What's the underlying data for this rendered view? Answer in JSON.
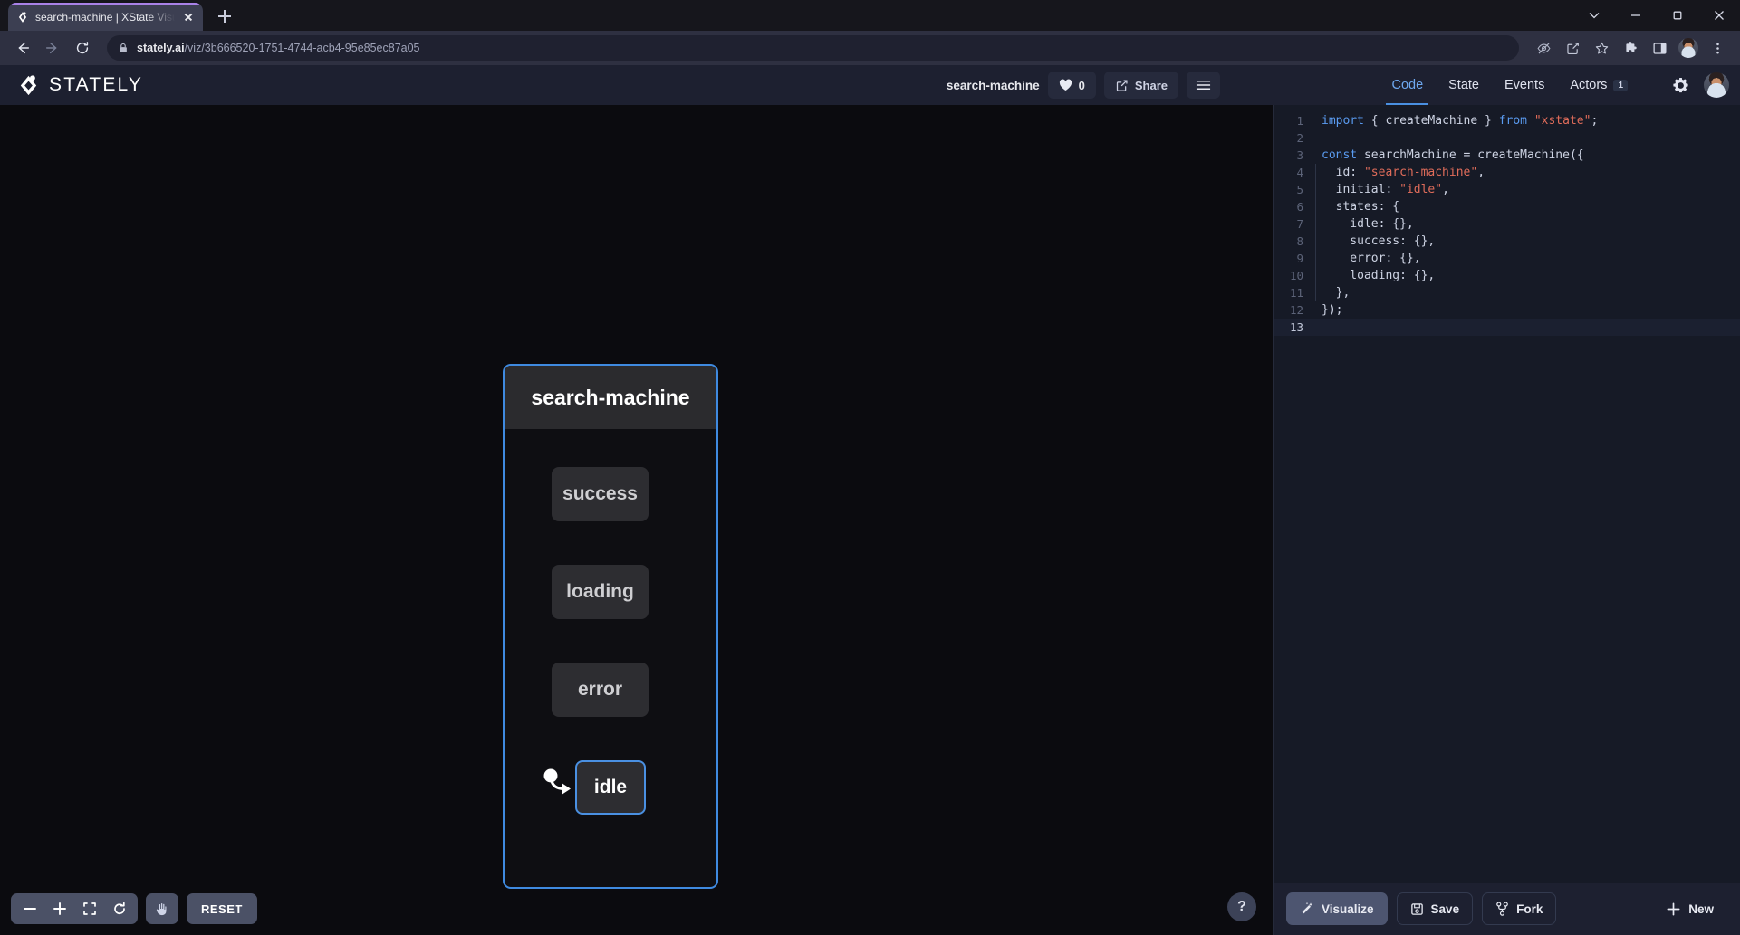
{
  "browser": {
    "tab": {
      "title": "search-machine | XState Visualize",
      "favicon_icon": "stately-logo-icon"
    },
    "new_tab_label": "+",
    "url_domain": "stately.ai",
    "url_path": "/viz/3b666520-1751-4744-acb4-95e85ec87a05",
    "window_controls": [
      "chevron-down-icon",
      "minimize-icon",
      "maximize-icon",
      "close-icon"
    ],
    "toolbar_icons": [
      "back-icon",
      "forward-icon",
      "reload-icon",
      "lock-icon",
      "eye-off-icon",
      "share-icon",
      "bookmark-star-icon",
      "extensions-puzzle-icon",
      "side-panel-icon",
      "profile-avatar-icon",
      "more-menu-icon"
    ]
  },
  "app": {
    "brand": "STATELY",
    "machine_name": "search-machine",
    "like_count": "0",
    "share_label": "Share",
    "menu_icon": "hamburger-menu-icon",
    "heart_icon": "heart-icon",
    "settings_icon": "gear-icon",
    "tabs": [
      {
        "label": "Code",
        "badge": "",
        "active": true
      },
      {
        "label": "State",
        "badge": "",
        "active": false
      },
      {
        "label": "Events",
        "badge": "",
        "active": false
      },
      {
        "label": "Actors",
        "badge": "1",
        "active": false
      }
    ]
  },
  "diagram": {
    "machine_title": "search-machine",
    "states": [
      {
        "label": "success",
        "initial": false
      },
      {
        "label": "loading",
        "initial": false
      },
      {
        "label": "error",
        "initial": false
      },
      {
        "label": "idle",
        "initial": true
      }
    ]
  },
  "canvas_toolbar": {
    "zoom_out_icon": "minus-icon",
    "zoom_in_icon": "plus-icon",
    "fit_icon": "fit-to-screen-icon",
    "reset_zoom_icon": "reset-circle-icon",
    "pan_icon": "hand-icon",
    "reset_label": "RESET",
    "help_label": "?"
  },
  "editor": {
    "lines": [
      {
        "n": "1",
        "indented": false,
        "tokens": [
          {
            "t": "import ",
            "c": "kw"
          },
          {
            "t": "{ createMachine } ",
            "c": "pl"
          },
          {
            "t": "from ",
            "c": "kw"
          },
          {
            "t": "\"xstate\"",
            "c": "str"
          },
          {
            "t": ";",
            "c": "pl"
          }
        ]
      },
      {
        "n": "2",
        "indented": false,
        "tokens": []
      },
      {
        "n": "3",
        "indented": false,
        "tokens": [
          {
            "t": "const ",
            "c": "kw"
          },
          {
            "t": "searchMachine = createMachine({",
            "c": "pl"
          }
        ]
      },
      {
        "n": "4",
        "indented": true,
        "tokens": [
          {
            "t": "  id: ",
            "c": "pl"
          },
          {
            "t": "\"search-machine\"",
            "c": "str"
          },
          {
            "t": ",",
            "c": "pl"
          }
        ]
      },
      {
        "n": "5",
        "indented": true,
        "tokens": [
          {
            "t": "  initial: ",
            "c": "pl"
          },
          {
            "t": "\"idle\"",
            "c": "str"
          },
          {
            "t": ",",
            "c": "pl"
          }
        ]
      },
      {
        "n": "6",
        "indented": true,
        "tokens": [
          {
            "t": "  states: {",
            "c": "pl"
          }
        ]
      },
      {
        "n": "7",
        "indented": true,
        "tokens": [
          {
            "t": "    idle: {},",
            "c": "pl"
          }
        ]
      },
      {
        "n": "8",
        "indented": true,
        "tokens": [
          {
            "t": "    success: {},",
            "c": "pl"
          }
        ]
      },
      {
        "n": "9",
        "indented": true,
        "tokens": [
          {
            "t": "    error: {},",
            "c": "pl"
          }
        ]
      },
      {
        "n": "10",
        "indented": true,
        "tokens": [
          {
            "t": "    loading: {},",
            "c": "pl"
          }
        ]
      },
      {
        "n": "11",
        "indented": true,
        "tokens": [
          {
            "t": "  },",
            "c": "pl"
          }
        ]
      },
      {
        "n": "12",
        "indented": false,
        "tokens": [
          {
            "t": "});",
            "c": "pl"
          }
        ]
      },
      {
        "n": "13",
        "indented": false,
        "current": true,
        "tokens": []
      }
    ],
    "footer": {
      "visualize_label": "Visualize",
      "save_label": "Save",
      "fork_label": "Fork",
      "new_label": "New",
      "visualize_icon": "magic-wand-icon",
      "save_icon": "floppy-disk-icon",
      "fork_icon": "fork-branch-icon",
      "new_icon": "plus-icon"
    }
  },
  "colors": {
    "accent_blue": "#4a90e2",
    "tab_accent": "#a982e8",
    "canvas_bg": "#0b0b0f",
    "panel_bg": "#161a26",
    "header_bg": "#1d2030"
  }
}
